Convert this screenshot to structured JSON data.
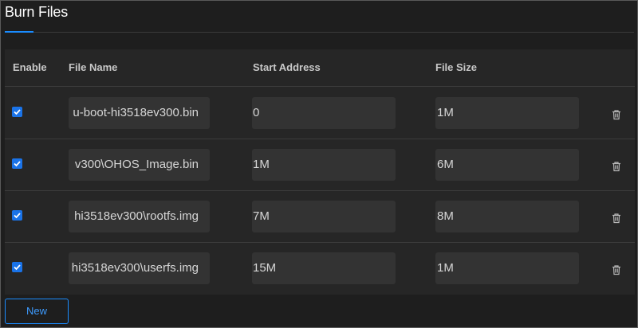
{
  "panel": {
    "title": "Burn Files"
  },
  "table": {
    "headers": {
      "enable": "Enable",
      "file_name": "File Name",
      "start_address": "Start Address",
      "file_size": "File Size"
    },
    "rows": [
      {
        "enabled": true,
        "file_name": "u-boot-hi3518ev300.bin",
        "start_address": "0",
        "file_size": "1M"
      },
      {
        "enabled": true,
        "file_name": "v300\\OHOS_Image.bin",
        "start_address": "1M",
        "file_size": "6M"
      },
      {
        "enabled": true,
        "file_name": "hi3518ev300\\rootfs.img",
        "start_address": "7M",
        "file_size": "8M"
      },
      {
        "enabled": true,
        "file_name": "hi3518ev300\\userfs.img",
        "start_address": "15M",
        "file_size": "1M"
      }
    ]
  },
  "actions": {
    "new_label": "New"
  },
  "colors": {
    "accent": "#1a8cff",
    "checkbox": "#1a73e8",
    "background": "#1e1e1e",
    "table_bg": "#262626",
    "field_bg": "#333333"
  },
  "icons": {
    "checkbox": "check-icon",
    "delete": "trash-icon"
  }
}
